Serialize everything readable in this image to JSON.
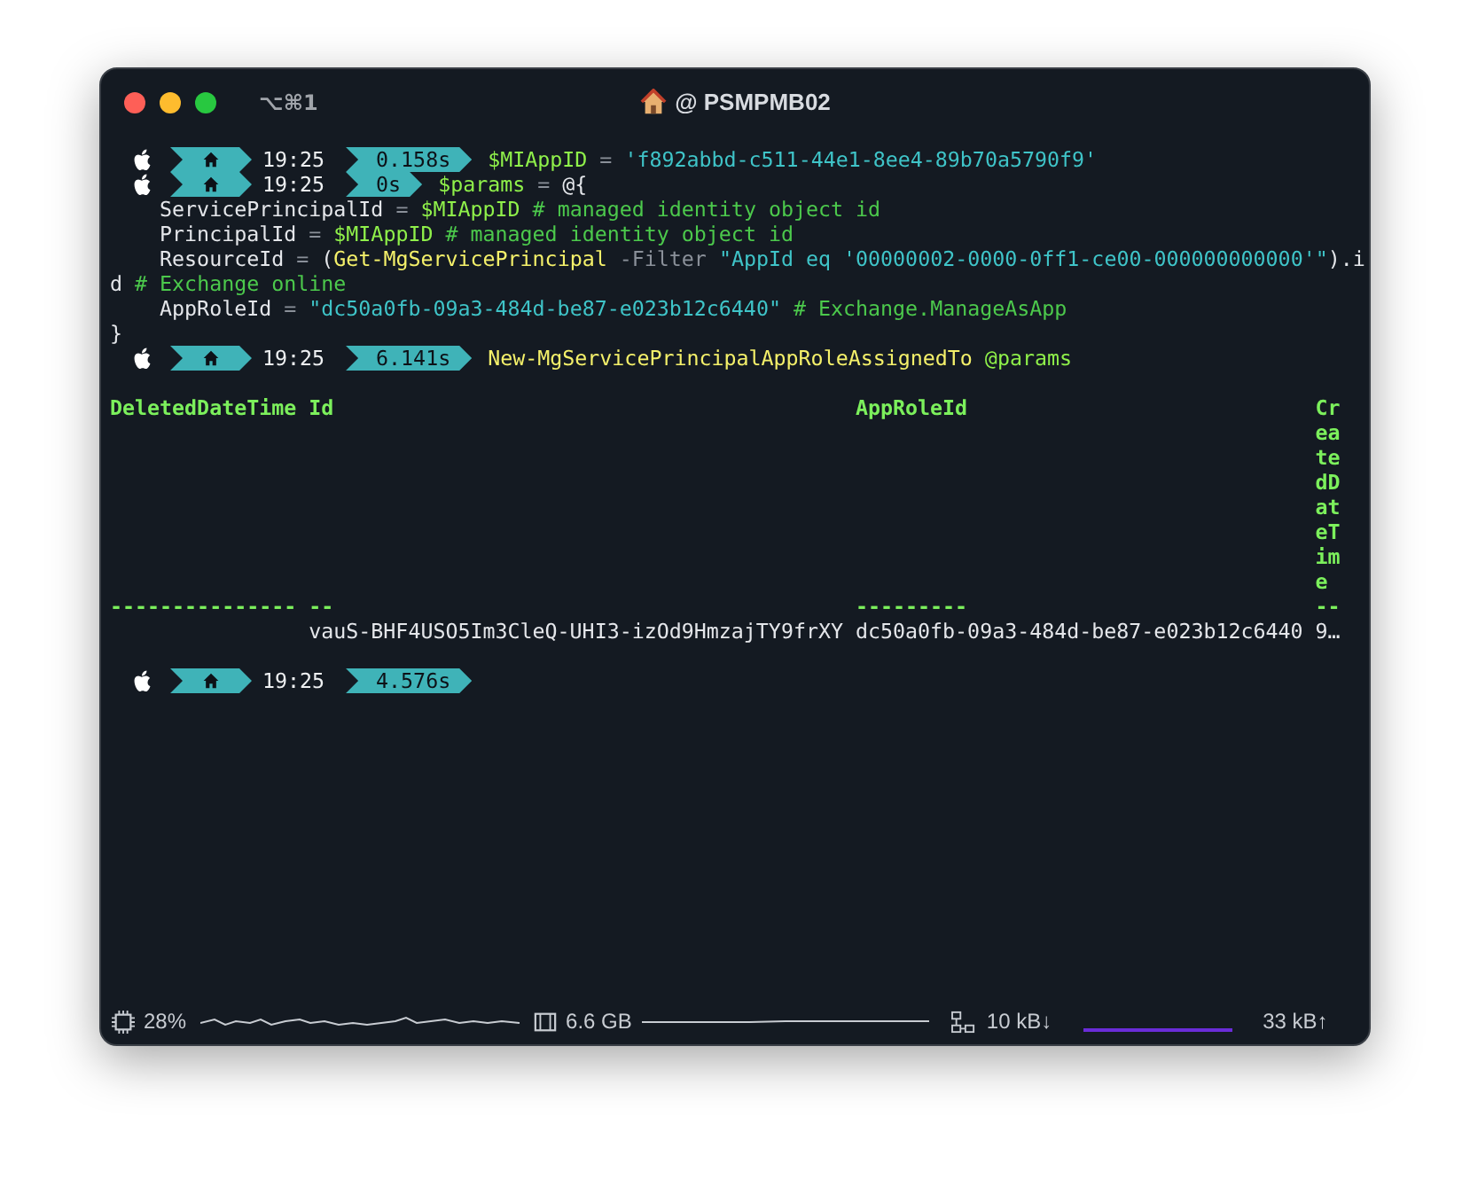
{
  "window": {
    "shortcut": "⌥⌘1",
    "title": "@ PSMPMB02"
  },
  "lines": [
    {
      "kind": "prompt",
      "time": "19:25",
      "duration": "0.158s",
      "segments": [
        {
          "text": "$MIAppID",
          "kind": "var"
        },
        {
          "text": " = ",
          "kind": "op"
        },
        {
          "text": "'f892abbd-c511-44e1-8ee4-89b70a5790f9'",
          "kind": "string"
        }
      ]
    },
    {
      "kind": "prompt",
      "time": "19:25",
      "duration": "0s",
      "segments": [
        {
          "text": "$params",
          "kind": "var"
        },
        {
          "text": " = ",
          "kind": "op"
        },
        {
          "text": "@{",
          "kind": "plain"
        }
      ]
    },
    {
      "kind": "code",
      "indent": true,
      "segments": [
        {
          "text": "ServicePrincipalId",
          "kind": "plain"
        },
        {
          "text": " = ",
          "kind": "op"
        },
        {
          "text": "$MIAppID",
          "kind": "var"
        },
        {
          "text": " # managed identity object id",
          "kind": "comment"
        }
      ]
    },
    {
      "kind": "code",
      "indent": true,
      "segments": [
        {
          "text": "PrincipalId",
          "kind": "plain"
        },
        {
          "text": " = ",
          "kind": "op"
        },
        {
          "text": "$MIAppID",
          "kind": "var"
        },
        {
          "text": " # managed identity object id",
          "kind": "comment"
        }
      ]
    },
    {
      "kind": "code",
      "indent": true,
      "segments": [
        {
          "text": "ResourceId",
          "kind": "plain"
        },
        {
          "text": " = ",
          "kind": "op"
        },
        {
          "text": "(",
          "kind": "plain"
        },
        {
          "text": "Get-MgServicePrincipal",
          "kind": "cmd"
        },
        {
          "text": " -Filter ",
          "kind": "param"
        },
        {
          "text": "\"AppId eq '00000002-0000-0ff1-ce00-000000000000'\"",
          "kind": "string"
        },
        {
          "text": ").i",
          "kind": "plain"
        }
      ]
    },
    {
      "kind": "code",
      "indent": false,
      "segments": [
        {
          "text": "d",
          "kind": "plain"
        },
        {
          "text": " # Exchange online",
          "kind": "comment"
        }
      ]
    },
    {
      "kind": "code",
      "indent": true,
      "segments": [
        {
          "text": "AppRoleId",
          "kind": "plain"
        },
        {
          "text": " = ",
          "kind": "op"
        },
        {
          "text": "\"dc50a0fb-09a3-484d-be87-e023b12c6440\"",
          "kind": "string"
        },
        {
          "text": " # Exchange.ManageAsApp",
          "kind": "comment"
        }
      ]
    },
    {
      "kind": "code",
      "indent": false,
      "segments": [
        {
          "text": "}",
          "kind": "plain"
        }
      ]
    },
    {
      "kind": "prompt",
      "time": "19:25",
      "duration": "6.141s",
      "segments": [
        {
          "text": "New-MgServicePrincipalAppRoleAssignedTo",
          "kind": "cmd"
        },
        {
          "text": " @params",
          "kind": "var"
        }
      ]
    },
    {
      "kind": "table",
      "columns": [
        {
          "header": "DeletedDateTime",
          "rule": "---------------"
        },
        {
          "header": "Id",
          "rule": "--",
          "value": "vauS-BHF4USO5Im3CleQ-UHI3-izOd9HmzajTY9frXY"
        },
        {
          "header": "AppRoleId",
          "rule": "---------",
          "value": "dc50a0fb-09a3-484d-be87-e023b12c6440"
        },
        {
          "header": "CreatedDateTime",
          "rule": "--",
          "value": "9…"
        }
      ]
    },
    {
      "kind": "prompt",
      "time": "19:25",
      "duration": "4.576s"
    }
  ],
  "status_bar": {
    "cpu": "28%",
    "memory": "6.6 GB",
    "download": "10 kB↓",
    "upload": "33 kB↑"
  }
}
